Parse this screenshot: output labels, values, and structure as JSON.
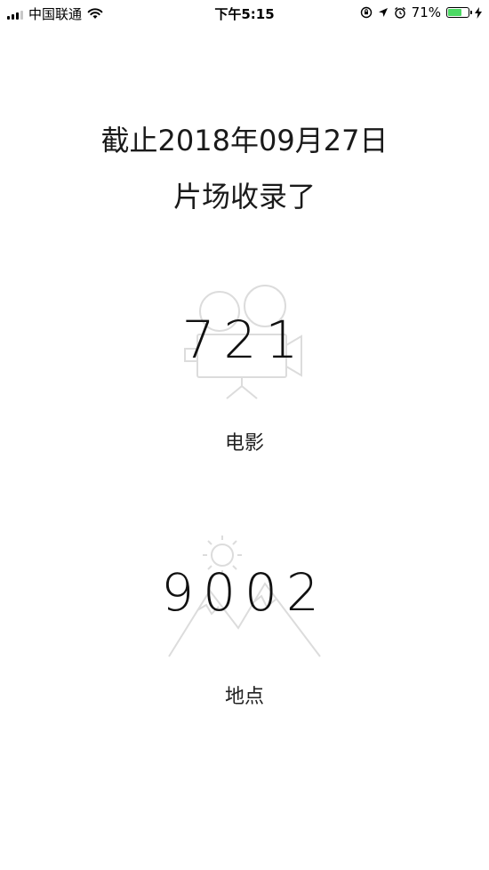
{
  "status_bar": {
    "carrier": "中国联通",
    "time": "下午5:15",
    "battery_percent": "71%",
    "battery_level": 0.71,
    "icons": [
      "signal-icon",
      "wifi-icon",
      "rotation-lock-icon",
      "location-icon",
      "alarm-icon",
      "battery-icon",
      "charging-icon"
    ]
  },
  "header": {
    "line1": "截止2018年09月27日",
    "line2": "片场收录了"
  },
  "stats": [
    {
      "value": "721",
      "label": "电影",
      "icon": "movie-camera-icon"
    },
    {
      "value": "9002",
      "label": "地点",
      "icon": "mountain-sun-icon"
    }
  ],
  "colors": {
    "background": "#ffffff",
    "text": "#111111",
    "icon_line": "#dcdcdc",
    "battery_fill": "#4cd964"
  }
}
